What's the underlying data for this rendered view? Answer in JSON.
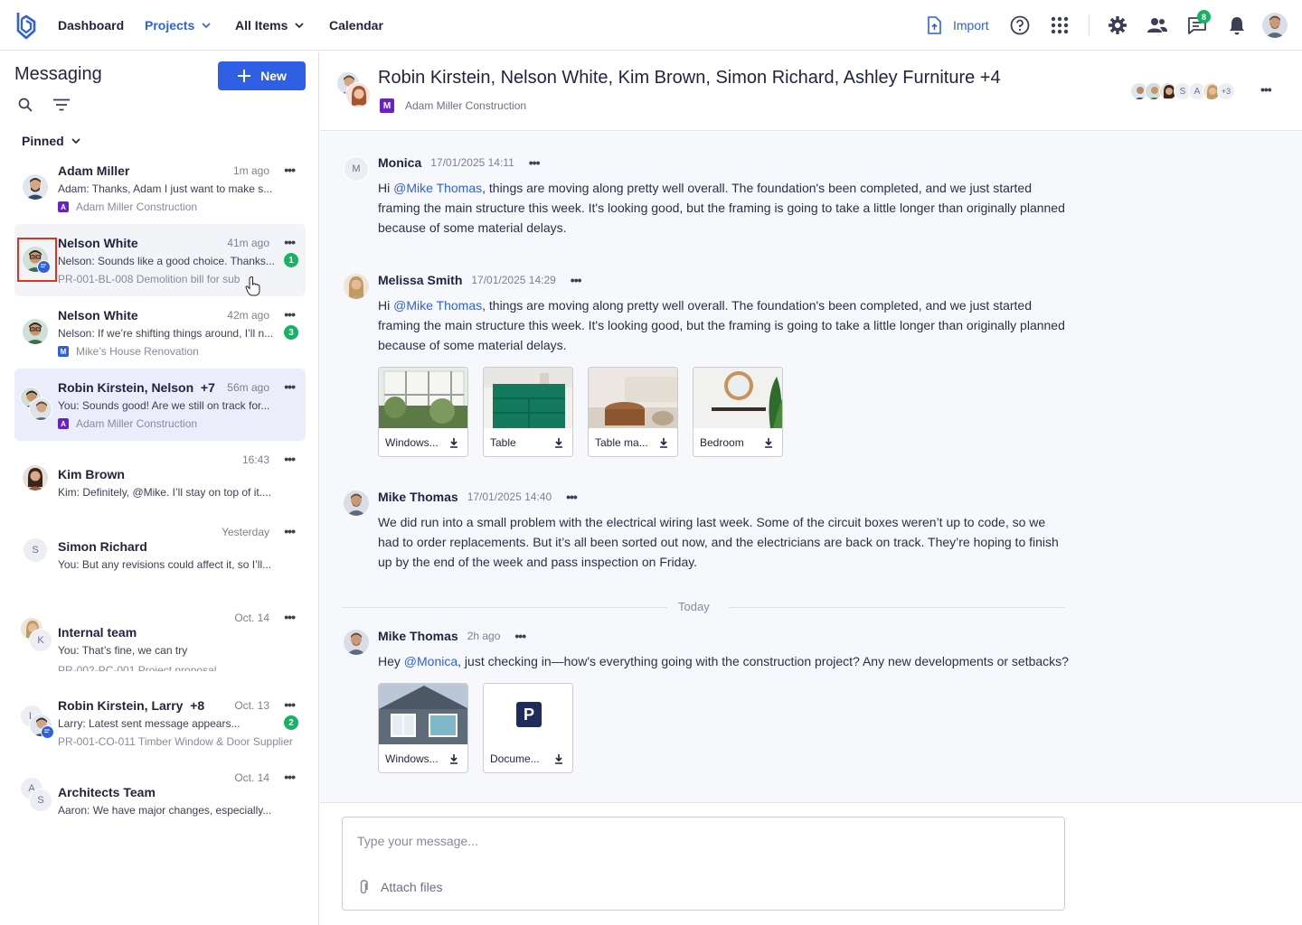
{
  "topnav": {
    "items": [
      {
        "label": "Dashboard"
      },
      {
        "label": "Projects",
        "active": true
      },
      {
        "label": "All Items"
      },
      {
        "label": "Calendar"
      }
    ],
    "import_label": "Import",
    "messages_badge": "8",
    "colors": {
      "accent": "#2f5fe3",
      "badge": "#16b364"
    }
  },
  "sidebar": {
    "title": "Messaging",
    "new_button": "New",
    "pinned_label": "Pinned",
    "conversations": [
      {
        "name": "Adam Miller",
        "time": "1m ago",
        "preview": "Adam: Thanks, Adam I just want to make s...",
        "project_letter": "A",
        "project": "Adam Miller Construction",
        "project_color": "#6b21c8"
      },
      {
        "name": "Nelson White",
        "time": "41m ago",
        "preview": "Nelson: Sounds like a good choice. Thanks...",
        "unread": "1",
        "project": "PR-001-BL-008 Demolition bill for sub"
      },
      {
        "name": "Nelson White",
        "time": "42m ago",
        "preview": "Nelson: If we’re shifting things around, I’ll n...",
        "unread": "3",
        "project_letter": "M",
        "project": "Mike’s House Renovation",
        "project_color": "#2f5fe3"
      },
      {
        "name": "Robin Kirstein, Nelson",
        "extra": "+7",
        "time": "56m ago",
        "preview": "You: Sounds good! Are we still on track for...",
        "project_letter": "A",
        "project": "Adam Miller Construction",
        "project_color": "#6b21c8"
      },
      {
        "name": "Kim Brown",
        "time": "16:43",
        "preview": "Kim: Definitely, @Mike. I’ll stay on top of it...."
      },
      {
        "name": "Simon Richard",
        "time": "Yesterday",
        "preview": "You: But any revisions could affect it, so I’ll...",
        "avatar_letter": "S"
      },
      {
        "name": "Internal team",
        "time": "Oct. 14",
        "preview": "You: That’s fine, we can try",
        "avatar_letter": "K",
        "project": "PR-002-PC-001 Project proposal"
      },
      {
        "name": "Robin Kirstein, Larry",
        "extra": "+8",
        "time": "Oct. 13",
        "preview": "Larry: Latest sent message appears...",
        "unread": "2",
        "project": "PR-001-CO-011 Timber Window & Door Supplier",
        "avatar_letter": "L"
      },
      {
        "name": "Architects Team",
        "time": "Oct. 14",
        "preview": "Aaron: We have major changes, especially...",
        "avatar_letter": "A",
        "avatar_letter2": "S"
      }
    ]
  },
  "chat": {
    "title": "Robin Kirstein, Nelson White, Kim Brown, Simon Richard, Ashley Furniture +4",
    "project_letter": "M",
    "project": "Adam Miller Construction",
    "participants_extra": "+3",
    "participant_letters": [
      "S",
      "A"
    ],
    "messages": [
      {
        "author": "Monica",
        "avatar_letter": "M",
        "time": "17/01/2025 14:11",
        "before": "Hi ",
        "mention": "@Mike Thomas",
        "after": ", things are moving along pretty well overall. The foundation's been completed, and we just started framing the main structure this week. It's looking good, but the framing is going to take a little longer than originally planned because of some material delays."
      },
      {
        "author": "Melissa Smith",
        "time": "17/01/2025 14:29",
        "before": "Hi ",
        "mention": "@Mike Thomas",
        "after": ", things are moving along pretty well overall. The foundation's been completed, and we just started framing the main structure this week. It's looking good, but the framing is going to take a little longer than originally planned because of some material delays.",
        "attachments": [
          "Windows...",
          "Table",
          "Table ma...",
          "Bedroom"
        ]
      },
      {
        "author": "Mike Thomas",
        "time": "17/01/2025 14:40",
        "text": "We did run into a small problem with the electrical wiring last week. Some of the circuit boxes weren’t up to code, so we had to order replacements. But it’s all been sorted out now, and the electricians are back on track. They’re hoping to finish up by the end of the week and pass inspection on Friday."
      },
      {
        "author": "Mike Thomas",
        "time": "2h ago",
        "before": "Hey ",
        "mention": "@Monica",
        "after": ", just checking in—how's everything going with the construction project? Any new developments or setbacks?",
        "attachments": [
          "Windows...",
          "Docume..."
        ],
        "doc_letter": "P"
      }
    ],
    "divider": "Today",
    "composer": {
      "placeholder": "Type your message...",
      "attach_label": "Attach files"
    }
  }
}
